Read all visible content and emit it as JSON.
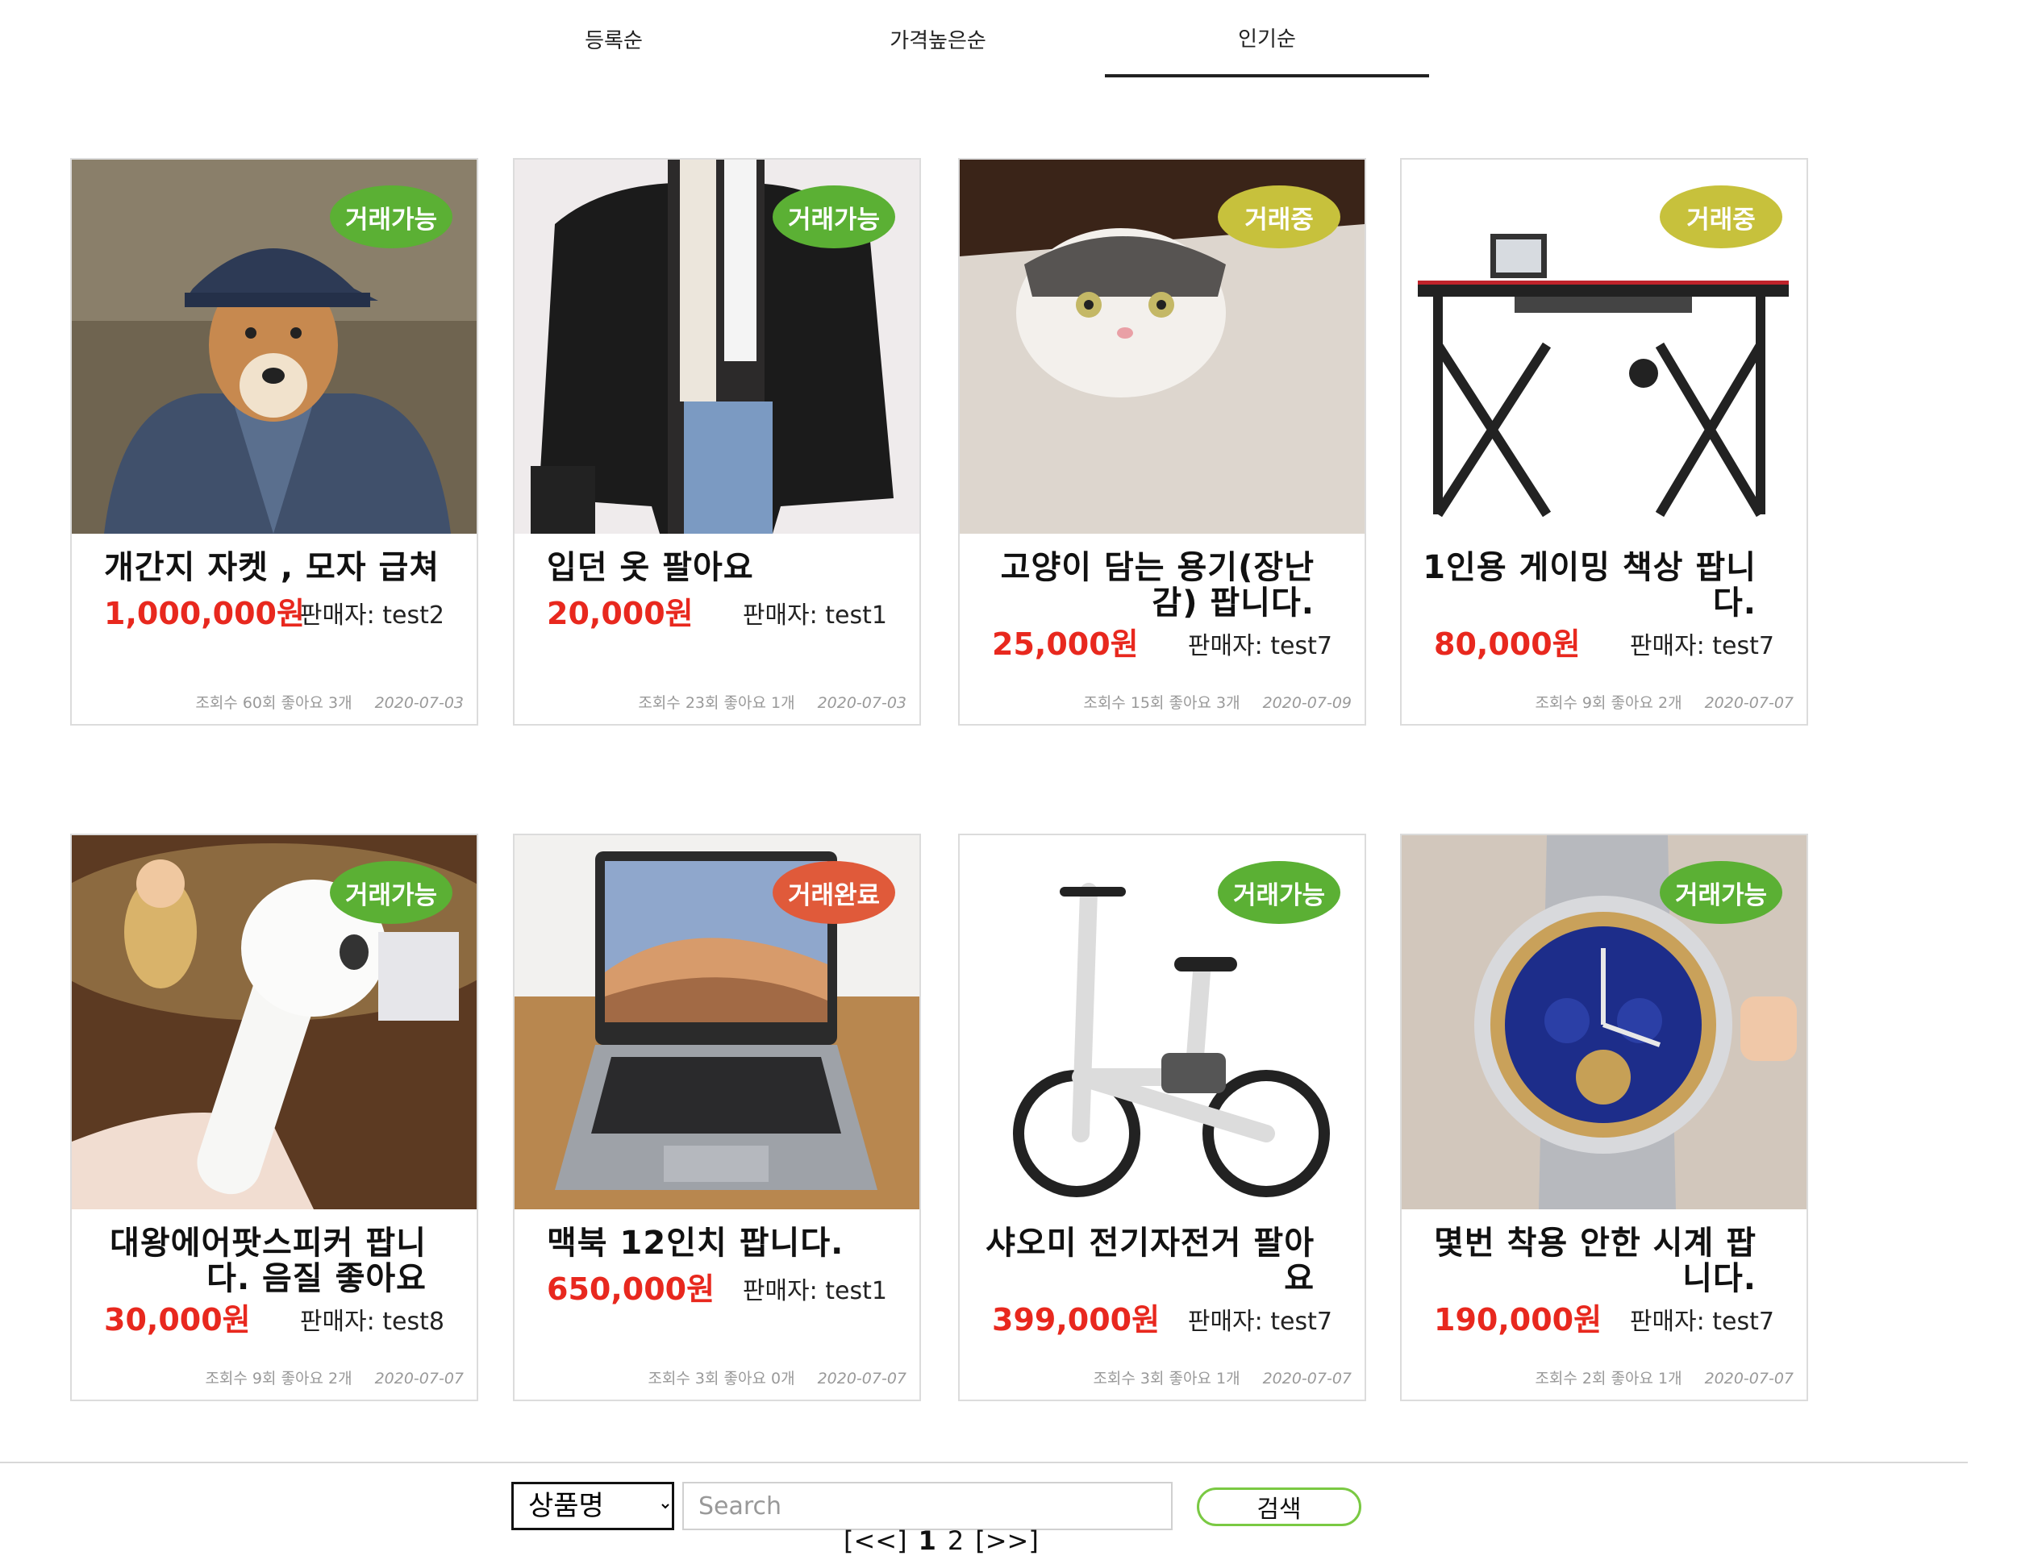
{
  "sort_tabs": [
    {
      "label": "등록순",
      "active": false
    },
    {
      "label": "가격높은순",
      "active": false
    },
    {
      "label": "인기순",
      "active": true
    }
  ],
  "products": [
    {
      "image": "dog-in-jacket",
      "status": "거래가능",
      "status_color": "#5bb034",
      "title": "개간지 자켓 , 모자 급쳐",
      "price": "1,000,000원",
      "seller": "판매자: test2",
      "stats": "조회수 60회 좋아요 3개",
      "date": "2020-07-03"
    },
    {
      "image": "puffer-jacket",
      "status": "거래가능",
      "status_color": "#5bb034",
      "title": "입던 옷 팔아요",
      "price": "20,000원",
      "seller": "판매자: test1",
      "stats": "조회수 23회 좋아요 1개",
      "date": "2020-07-03"
    },
    {
      "image": "cat-in-box",
      "status": "거래중",
      "status_color": "#c7c13c",
      "title": "고양이 담는 용기(장난 감) 팝니다.",
      "price": "25,000원",
      "seller": "판매자: test7",
      "stats": "조회수 15회 좋아요 3개",
      "date": "2020-07-09"
    },
    {
      "image": "gaming-desk",
      "status": "거래중",
      "status_color": "#c7c13c",
      "title": "1인용 게이밍 책상 팝니 다.",
      "price": "80,000원",
      "seller": "판매자: test7",
      "stats": "조회수 9회 좋아요 2개",
      "date": "2020-07-07"
    },
    {
      "image": "giant-earbud",
      "status": "거래가능",
      "status_color": "#5bb034",
      "title": "대왕에어팟스피커 팝니 다. 음질 좋아요",
      "price": "30,000원",
      "seller": "판매자: test8",
      "stats": "조회수 9회 좋아요 2개",
      "date": "2020-07-07"
    },
    {
      "image": "macbook",
      "status": "거래완료",
      "status_color": "#e05a3a",
      "title": "맥북 12인치 팝니다.",
      "price": "650,000원",
      "seller": "판매자: test1",
      "stats": "조회수 3회 좋아요 0개",
      "date": "2020-07-07"
    },
    {
      "image": "folding-bike",
      "status": "거래가능",
      "status_color": "#5bb034",
      "title": "샤오미 전기자전거 팔아 요",
      "price": "399,000원",
      "seller": "판매자: test7",
      "stats": "조회수 3회 좋아요 1개",
      "date": "2020-07-07"
    },
    {
      "image": "wristwatch",
      "status": "거래가능",
      "status_color": "#5bb034",
      "title": "몇번 착용 안한 시계 팝 니다.",
      "price": "190,000원",
      "seller": "판매자: test7",
      "stats": "조회수 2회 좋아요 1개",
      "date": "2020-07-07"
    }
  ],
  "search": {
    "select_value": "상품명",
    "placeholder": "Search",
    "button_label": "검색"
  },
  "pagination": {
    "first": "[<<]",
    "pages": [
      "1",
      "2"
    ],
    "current": "1",
    "next": "[>>]"
  }
}
